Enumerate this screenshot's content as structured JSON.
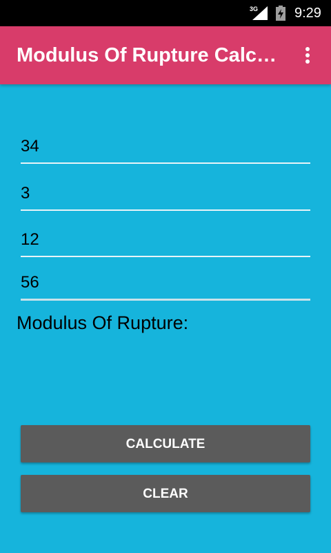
{
  "status_bar": {
    "network": "3G",
    "time": "9:29",
    "icons": [
      "signal-icon",
      "battery-charging-icon"
    ]
  },
  "app_bar": {
    "title": "Modulus Of Rupture Calcul…",
    "background": "#d83c6a",
    "overflow_icon": "more-vert-icon"
  },
  "form": {
    "fields": [
      {
        "value": "34"
      },
      {
        "value": "3"
      },
      {
        "value": "12"
      },
      {
        "value": "56"
      }
    ],
    "result_label": "Modulus Of Rupture:"
  },
  "buttons": {
    "calculate_label": "CALCULATE",
    "clear_label": "CLEAR"
  },
  "colors": {
    "background": "#16b4dc",
    "button": "#5b5b5b"
  }
}
